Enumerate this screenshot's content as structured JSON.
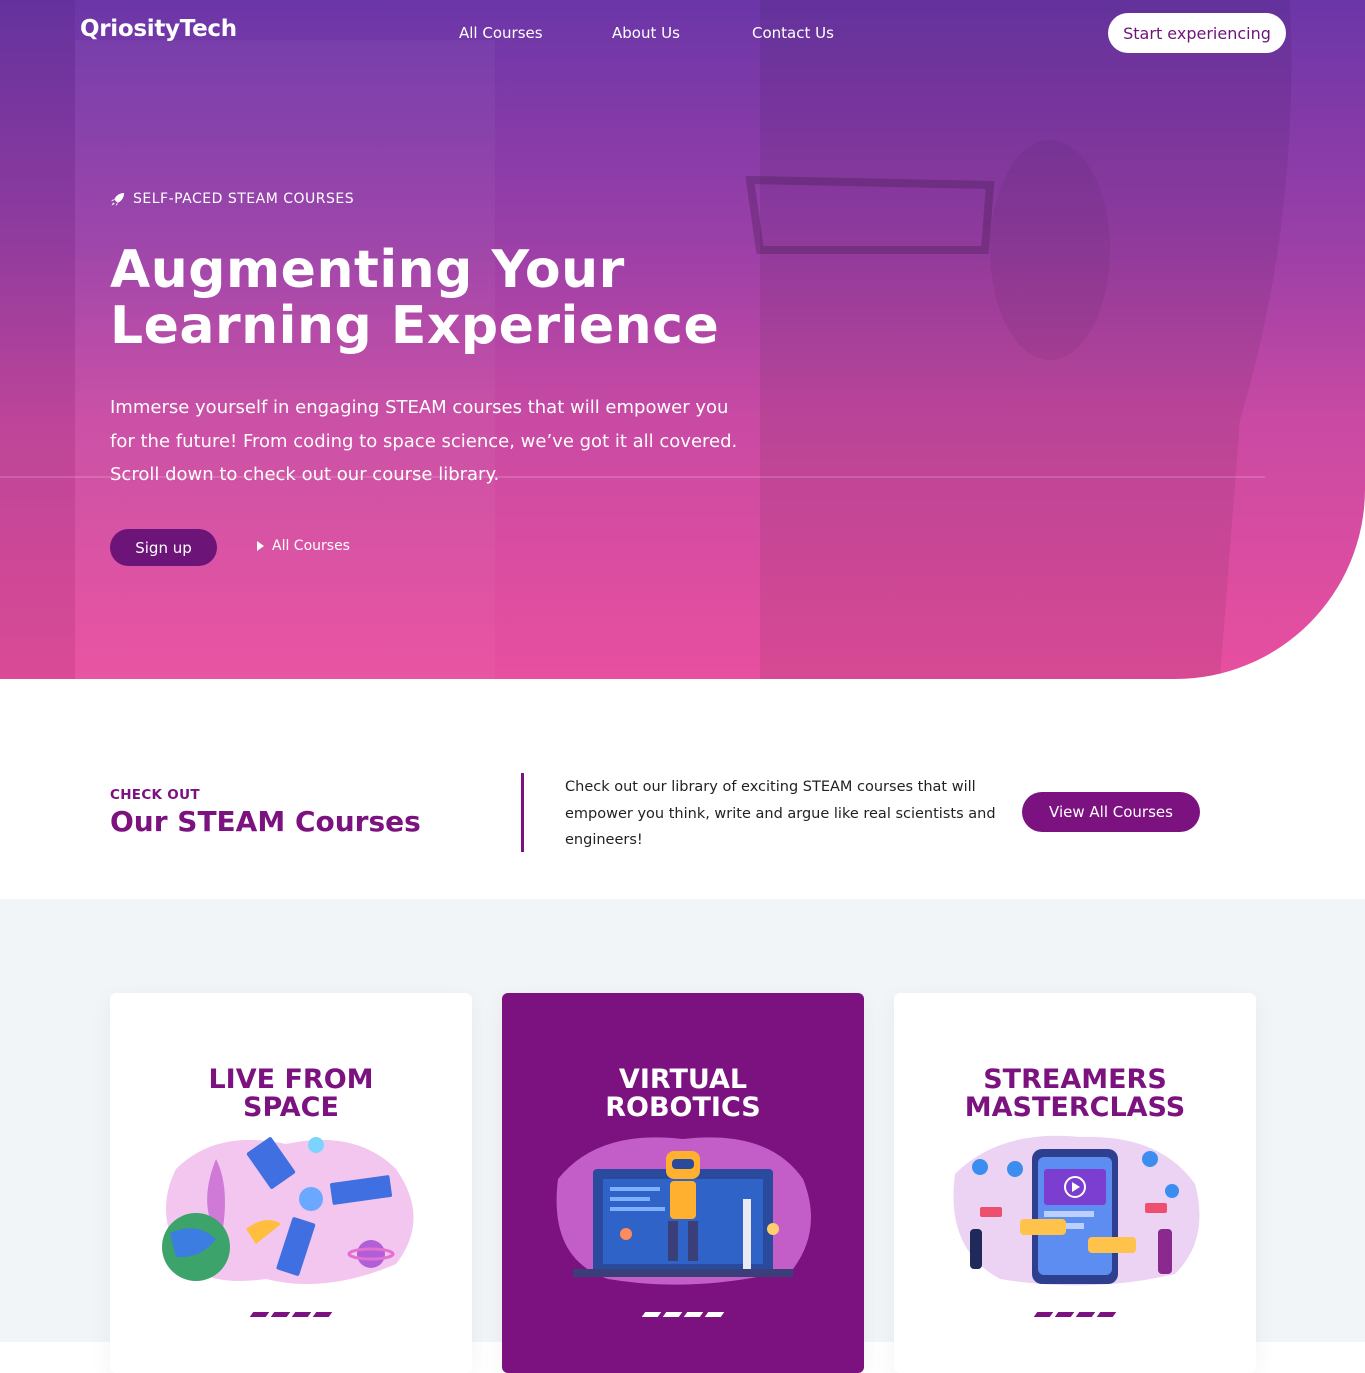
{
  "nav": {
    "logo": "QriosityTech",
    "links": [
      "All Courses",
      "About Us",
      "Contact Us"
    ],
    "cta": "Start experiencing"
  },
  "hero": {
    "eyebrow": "SELF-PACED STEAM COURSES",
    "eyebrow_icon": "rocket-icon",
    "title_line1": "Augmenting Your",
    "title_line2": "Learning Experience",
    "text": "Immerse yourself in engaging STEAM courses that will empower you for the future! From coding to space science, we’ve got it all covered. Scroll down to check out our course library.",
    "signup": "Sign up",
    "courses_link": "All Courses",
    "courses_link_icon": "play-triangle-icon"
  },
  "intro": {
    "kicker": "CHECK OUT",
    "title": "Our STEAM Courses",
    "text": "Check out our library of exciting STEAM courses that will empower you think, write and argue like real scientists and engineers!",
    "button": "View All Courses"
  },
  "courses": [
    {
      "line1": "LIVE FROM",
      "line2": "SPACE",
      "illustration": "space-illustration"
    },
    {
      "line1": "VIRTUAL",
      "line2": "ROBOTICS",
      "illustration": "robotics-illustration"
    },
    {
      "line1": "STREAMERS",
      "line2": "MASTERCLASS",
      "illustration": "streaming-illustration"
    }
  ],
  "colors": {
    "brand": "#7b1280",
    "hero_top": "#6b36a8",
    "hero_bottom": "#e84f9f",
    "section_bg": "#f1f5f7"
  }
}
